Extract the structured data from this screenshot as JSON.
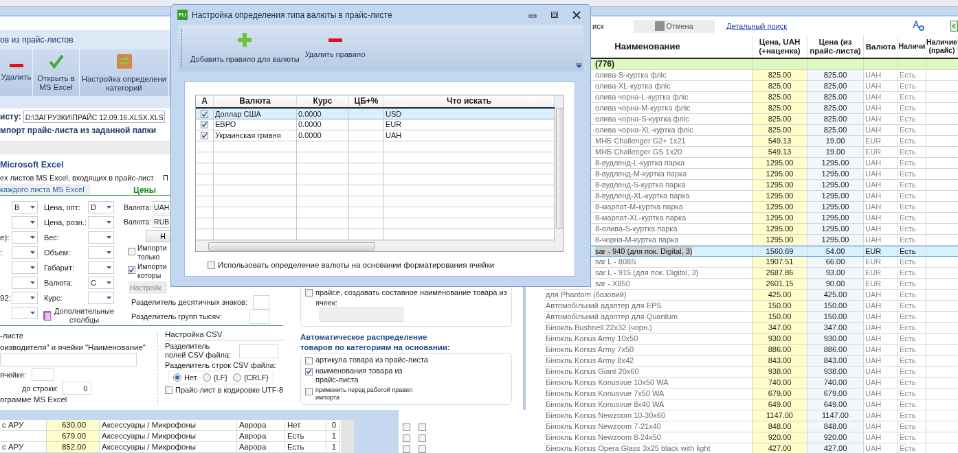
{
  "left_panel": {
    "title": "ов из прайс-листов",
    "toolbar": [
      {
        "label": "Удалить"
      },
      {
        "label": "Открыть в\nMS Excel"
      },
      {
        "label": "Настройка определени\nкатегорий"
      }
    ],
    "file_label": "исту:",
    "file_path": "D:\\ЗАГРУЗКИ\\ПРАЙС 12.09.16.XLSX.XLS",
    "folder_import": "мпорт прайс-листа из заданной папки",
    "excel_heading": "Microsoft Excel",
    "sheets_option": "ех листов MS Excel, входящих в прайс-лист",
    "sheets_option_2": "П",
    "sheet_tab": "каждого листа MS Excel",
    "prices_heading": "Цены",
    "columns_left": [
      {
        "kind": "combo",
        "value": "B"
      },
      {
        "kind": "combo"
      },
      {
        "kind": "combo",
        "label": "е):"
      },
      {
        "kind": "combo",
        "label": ":"
      },
      {
        "kind": "combo"
      },
      {
        "kind": "combo"
      },
      {
        "kind": "combo",
        "label": "92:"
      },
      {
        "kind": "combo"
      }
    ],
    "columns_mid": [
      {
        "label": "Цена, опт:",
        "value": "D"
      },
      {
        "label": "Цена, розн.:"
      },
      {
        "label": "Вес:"
      },
      {
        "label": "Объем:"
      },
      {
        "label": "Габарит:"
      },
      {
        "label": "Валюта:",
        "value": "C"
      },
      {
        "label": "Курс:"
      }
    ],
    "extra_columns": "Дополнительные\nстолбцы",
    "currencies": [
      {
        "label": "Валюта:",
        "value": "UAH"
      },
      {
        "label": "Валюта:",
        "value": "RUB"
      }
    ],
    "small_button": "Н",
    "import_checks": [
      {
        "label": "Импорти\nтолько",
        "checked": false
      },
      {
        "label": "Импорти\nкоторы",
        "checked": true
      }
    ],
    "settings_button": {
      "label": "Настройк",
      "disabled": true
    },
    "separators": [
      "Разделитель десятичных знаков:",
      "Разделитель групп тысяч:"
    ],
    "lower": {
      "line1": "-листе",
      "line2": "оизводителя\" и ячейки \"Наименование\"",
      "in_cell": "ячейке:",
      "to_row": "до строки:",
      "to_row_value": "0",
      "excel_program": "ограмме MS Excel"
    },
    "csv": {
      "heading": "Настройка CSV",
      "field_sep": "Разделитель\nполей CSV файла:",
      "line_sep": "Разделитель строк CSV файла:",
      "options": [
        {
          "label": "Нет",
          "selected": true
        },
        {
          "label": "{LF}",
          "selected": false
        },
        {
          "label": "{CRLF}",
          "selected": false
        }
      ],
      "utf8": {
        "label": "Прайс-лист в кодировке UTF-8",
        "checked": false
      }
    },
    "name_fallback": {
      "label": "прайсе, создавать составное наименование товара из ячеек:",
      "checked": false
    },
    "auto_category": {
      "heading": "Автоматическое распределение\nтоваров по категориям на основании:",
      "options": [
        {
          "kind": "option",
          "label": "артикула товара из прайс-листа",
          "checked": false
        },
        {
          "kind": "option",
          "label": "наименования товара из\nпрайс-листа",
          "checked": true
        },
        {
          "kind": "note",
          "label": "применить перед работой правил\nимпорта",
          "checked": false
        }
      ]
    }
  },
  "lower_table": {
    "rows": [
      {
        "name": "с АРУ",
        "price": "630.00",
        "category": "Аксессуары / Микрофоны",
        "brand": "Аврора",
        "stock": "Нет",
        "qty": "0"
      },
      {
        "price": "679.00",
        "category": "Аксессуары / Микрофоны",
        "brand": "Аврора",
        "stock": "Есть",
        "qty": "1"
      },
      {
        "name": "с АРУ",
        "price": "852.00",
        "category": "Аксессуары / Микрофоны",
        "brand": "Аврора",
        "stock": "Есть",
        "qty": "1"
      }
    ]
  },
  "grid": {
    "search_label": "иск",
    "cancel": "Отмена",
    "detail_link": "Детальный поиск",
    "columns": [
      "Наименование",
      "Цена, UAH\n(+наценка)",
      "Цена (из\nпрайс-листа)",
      "Валюта",
      "Наличи",
      "Наличие\n(прайс)"
    ],
    "group_label": "(776)",
    "rows": [
      {
        "name": "олива-S-куртка фліс",
        "markup": "825.00",
        "price": "825.00",
        "currency": "UAH",
        "stock": "Есть",
        "selected": false
      },
      {
        "name": "олива-XL-куртка фліс",
        "markup": "825.00",
        "price": "825.00",
        "currency": "UAH",
        "stock": "Есть",
        "selected": false
      },
      {
        "name": "олива чорна-L-куртка фліс",
        "markup": "825.00",
        "price": "825.00",
        "currency": "UAH",
        "stock": "Есть",
        "selected": false
      },
      {
        "name": "олива чорна-M-куртка фліс",
        "markup": "825.00",
        "price": "825.00",
        "currency": "UAH",
        "stock": "Есть",
        "selected": false
      },
      {
        "name": "олива чорна-S-куртка фліс",
        "markup": "825.00",
        "price": "825.00",
        "currency": "UAH",
        "stock": "Есть",
        "selected": false
      },
      {
        "name": "олива чорна-XL-куртка фліс",
        "markup": "825.00",
        "price": "825.00",
        "currency": "UAH",
        "stock": "Есть",
        "selected": false
      },
      {
        "name": "МНБ Challenger G2+ 1x21",
        "markup": "549.13",
        "price": "19.00",
        "currency": "EUR",
        "stock": "Есть",
        "selected": false
      },
      {
        "name": "МНБ Challenger GS 1x20",
        "markup": "549.13",
        "price": "19.00",
        "currency": "EUR",
        "stock": "Есть",
        "selected": false
      },
      {
        "name": "8-вудленд-L-куртка парка",
        "markup": "1295.00",
        "price": "1295.00",
        "currency": "UAH",
        "stock": "Есть",
        "selected": false
      },
      {
        "name": "8-вудленд-M-куртка парка",
        "markup": "1295.00",
        "price": "1295.00",
        "currency": "UAH",
        "stock": "Есть",
        "selected": false
      },
      {
        "name": "8-вудленд-S-куртка парка",
        "markup": "1295.00",
        "price": "1295.00",
        "currency": "UAH",
        "stock": "Есть",
        "selected": false
      },
      {
        "name": "8-вудленд-XL-куртка парка",
        "markup": "1295.00",
        "price": "1295.00",
        "currency": "UAH",
        "stock": "Есть",
        "selected": false
      },
      {
        "name": "8-марпат-M-куртка парка",
        "markup": "1295.00",
        "price": "1295.00",
        "currency": "UAH",
        "stock": "Есть",
        "selected": false
      },
      {
        "name": "8-марпат-XL-куртка парка",
        "markup": "1295.00",
        "price": "1295.00",
        "currency": "UAH",
        "stock": "Есть",
        "selected": false
      },
      {
        "name": "8-олива-S-куртка парка",
        "markup": "1295.00",
        "price": "1295.00",
        "currency": "UAH",
        "stock": "Есть",
        "selected": false
      },
      {
        "name": "8-чорна-M-куртка парка",
        "markup": "1295.00",
        "price": "1295.00",
        "currency": "UAH",
        "stock": "Есть",
        "selected": false
      },
      {
        "name": "sar - 940 (для пок. Digital, 3)",
        "markup": "1560.69",
        "price": "54.00",
        "currency": "EUR",
        "stock": "Есть",
        "selected": true
      },
      {
        "name": "sar L - 808S",
        "markup": "1907.51",
        "price": "66.00",
        "currency": "EUR",
        "stock": "Есть",
        "selected": false
      },
      {
        "name": "sar L - 915 (для пок. Digital, 3)",
        "markup": "2687.86",
        "price": "93.00",
        "currency": "EUR",
        "stock": "Есть",
        "selected": false
      },
      {
        "name": "sar - X850",
        "markup": "2601.15",
        "price": "90.00",
        "currency": "EUR",
        "stock": "Есть",
        "selected": false
      },
      {
        "name": "для Phantom  (базовий)",
        "markup": "425.00",
        "price": "425.00",
        "currency": "UAH",
        "stock": "Есть",
        "selected": false
      },
      {
        "name": "Автомобільний адаптер для EPS",
        "markup": "150.00",
        "price": "150.00",
        "currency": "UAH",
        "stock": "Есть",
        "selected": false
      },
      {
        "name": "Автомобільний адаптер для Quantum",
        "markup": "150.00",
        "price": "150.00",
        "currency": "UAH",
        "stock": "Есть",
        "selected": false
      },
      {
        "name": "Бінокль Bushnell 22x32 (чорн.)",
        "markup": "347.00",
        "price": "347.00",
        "currency": "UAH",
        "stock": "Есть",
        "selected": false
      },
      {
        "name": "Бінокль Konus Army 10x50",
        "markup": "930.00",
        "price": "930.00",
        "currency": "UAH",
        "stock": "Есть",
        "selected": false
      },
      {
        "name": "Бінокль Konus Army 7x50",
        "markup": "886.00",
        "price": "886.00",
        "currency": "UAH",
        "stock": "Есть",
        "selected": false
      },
      {
        "name": "Бінокль Konus Army 8x42",
        "markup": "843.00",
        "price": "843.00",
        "currency": "UAH",
        "stock": "Есть",
        "selected": false
      },
      {
        "name": "Бінокль Konus Giant 20x60",
        "markup": "938.00",
        "price": "938.00",
        "currency": "UAH",
        "stock": "Есть",
        "selected": false
      },
      {
        "name": "Бінокль Konus Konusvue 10x50 WA",
        "markup": "740.00",
        "price": "740.00",
        "currency": "UAH",
        "stock": "Есть",
        "selected": false
      },
      {
        "name": "Бінокль Konus Konusvue 7x50 WA",
        "markup": "679.00",
        "price": "679.00",
        "currency": "UAH",
        "stock": "Есть",
        "selected": false
      },
      {
        "name": "Бінокль Konus Konusvue 8x40 WA",
        "markup": "649.00",
        "price": "649.00",
        "currency": "UAH",
        "stock": "Есть",
        "selected": false
      },
      {
        "name": "Бінокль Konus Newzoom 10-30x60",
        "markup": "1147.00",
        "price": "1147.00",
        "currency": "UAH",
        "stock": "Есть",
        "selected": false
      },
      {
        "name": "Бінокль Konus Newzoom 7-21x40",
        "markup": "848.00",
        "price": "848.00",
        "currency": "UAH",
        "stock": "Есть",
        "selected": false,
        "checks": [
          false,
          false
        ]
      },
      {
        "name": "Бінокль Konus Newzoom 8-24x50",
        "markup": "920.00",
        "price": "920.00",
        "currency": "UAH",
        "stock": "Есть",
        "selected": false,
        "checks": [
          false,
          false
        ]
      },
      {
        "name": "Бінокль Konus Opera Glass 3x25 black with light",
        "markup": "427.00",
        "price": "427.00",
        "currency": "UAH",
        "stock": "Есть",
        "selected": false,
        "checks": [
          false,
          false
        ]
      }
    ]
  },
  "dialog": {
    "app_icon": "PLi",
    "title": "Настройка определения типа валюты в прайс-листе",
    "toolbar": [
      {
        "label": "Добавить правило для валюты"
      },
      {
        "label": "Удалить правило"
      }
    ],
    "columns": [
      "А",
      "Валюта",
      "Курс",
      "ЦБ+%",
      "Что искать"
    ],
    "rows": [
      {
        "active": true,
        "currency": "Доллар США",
        "rate": "0.0000",
        "search": "USD",
        "selected": true
      },
      {
        "active": true,
        "currency": "ЕВРО",
        "rate": "0.0000",
        "search": "EUR",
        "selected": false
      },
      {
        "active": true,
        "currency": "Украинская гривня",
        "rate": "0.0000",
        "search": "UAH",
        "selected": false
      }
    ],
    "format_option": {
      "label": "Использовать определение валюты на основании форматирования ячейки",
      "checked": false
    }
  }
}
